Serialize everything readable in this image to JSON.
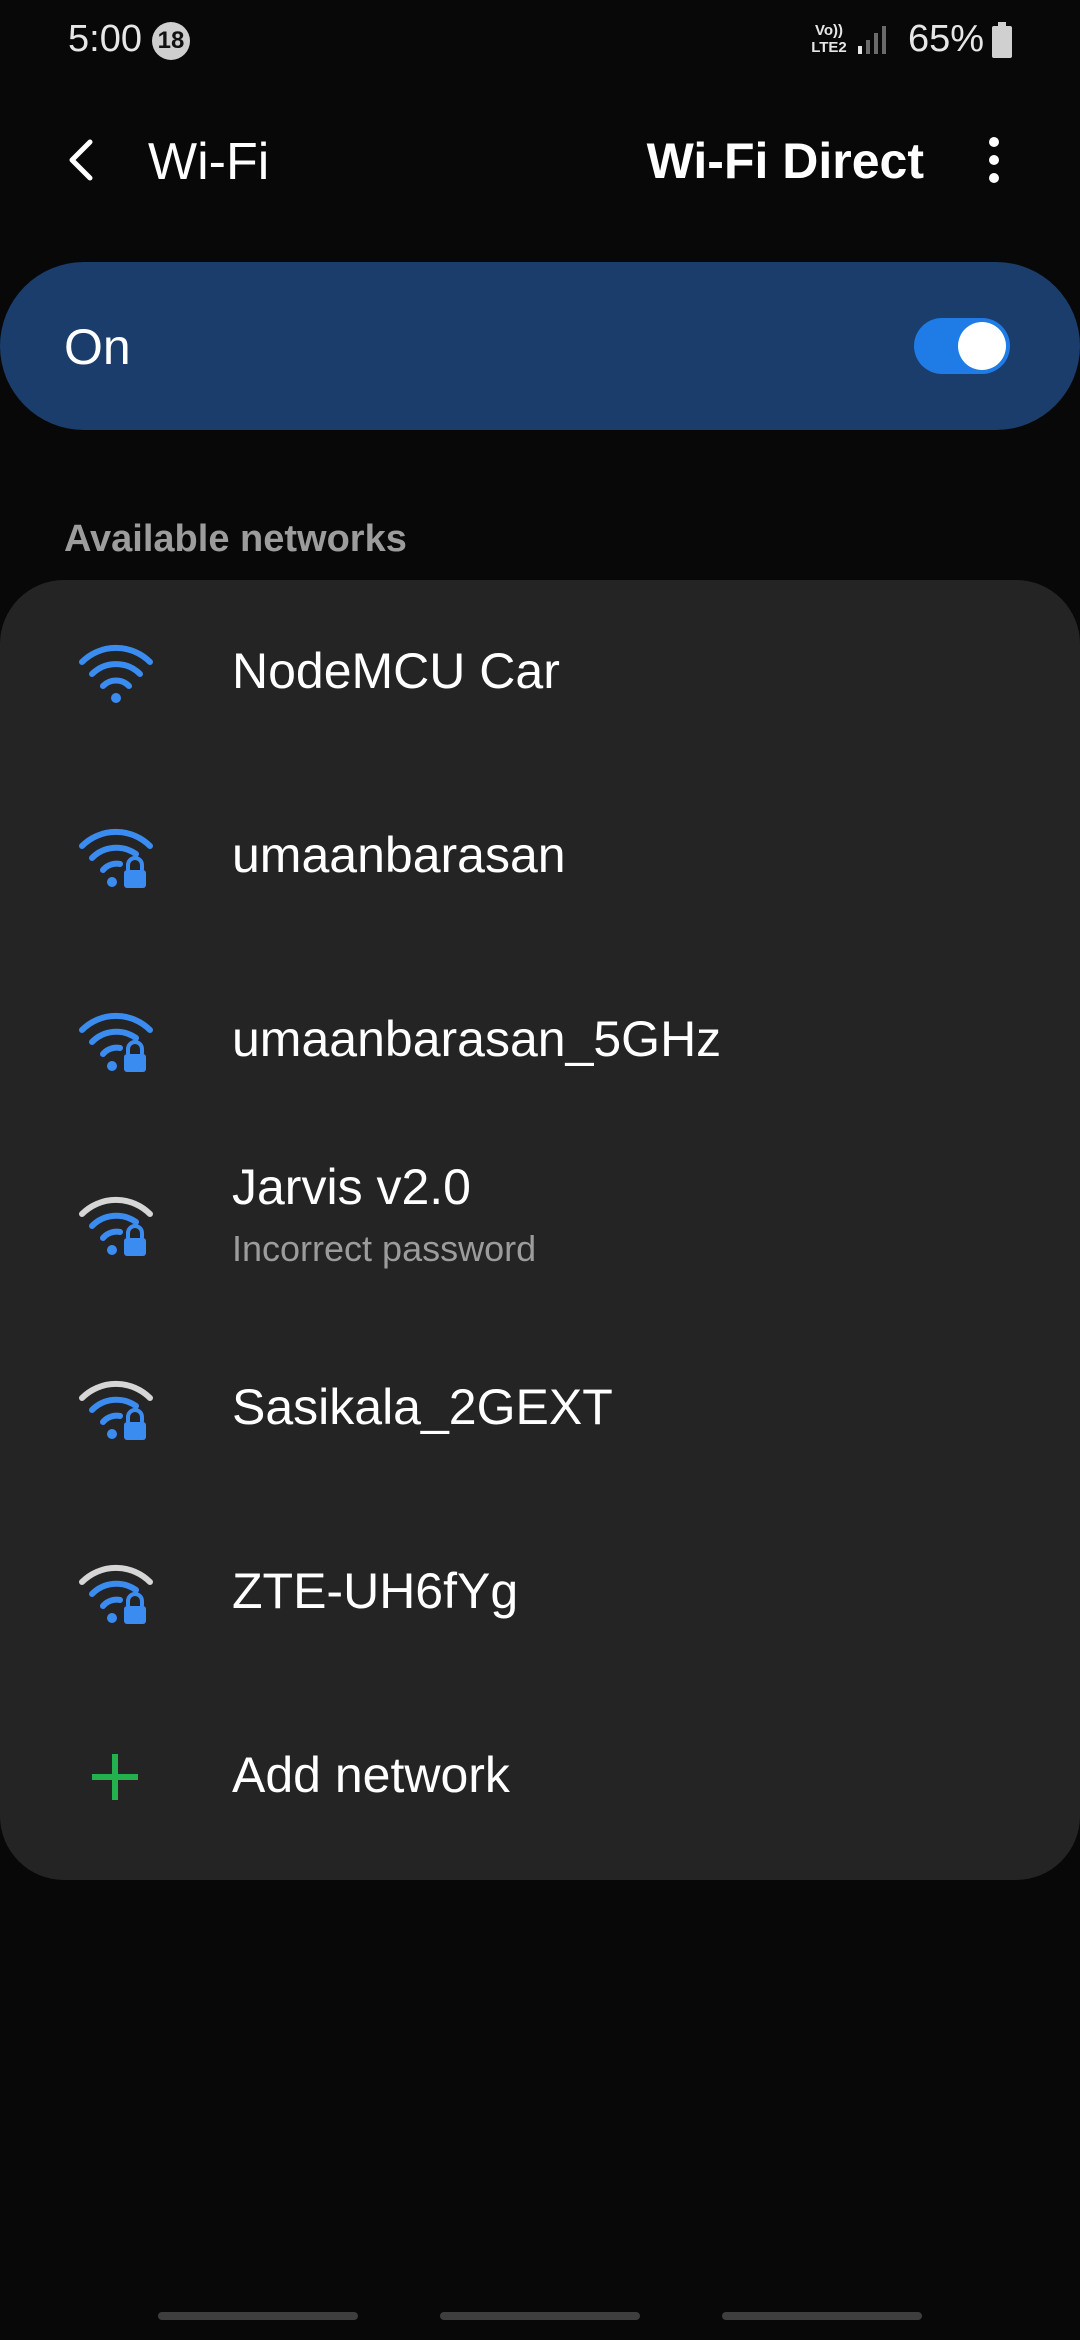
{
  "status_bar": {
    "time": "5:00",
    "notification_count": "18",
    "volte_line1": "Vo))",
    "volte_line2": "LTE2",
    "battery_percent": "65%"
  },
  "header": {
    "title": "Wi-Fi",
    "wifi_direct_label": "Wi-Fi Direct",
    "back_icon": "back-arrow-icon",
    "more_icon": "more-vertical-icon"
  },
  "master_switch": {
    "label": "On",
    "state": true
  },
  "networks_section": {
    "header": "Available networks",
    "networks": [
      {
        "name": "NodeMCU Car",
        "secured": false,
        "icon_color": "#3b8cf0"
      },
      {
        "name": "umaanbarasan",
        "secured": true,
        "icon_color": "#3b8cf0"
      },
      {
        "name": "umaanbarasan_5GHz",
        "secured": true,
        "icon_color": "#3b8cf0"
      },
      {
        "name": "Jarvis v2.0",
        "subtitle": "Incorrect password",
        "secured": true,
        "icon_color": "#d6d6d6"
      },
      {
        "name": "Sasikala_2GEXT",
        "secured": true,
        "icon_color": "#d6d6d6"
      },
      {
        "name": "ZTE-UH6fYg",
        "secured": true,
        "icon_color": "#d6d6d6"
      }
    ],
    "add_network_label": "Add network",
    "add_icon_color": "#23b14d"
  },
  "colors": {
    "background": "#080808",
    "card": "#242424",
    "switch_bar": "#1b3d6b",
    "accent": "#1f7be6"
  }
}
